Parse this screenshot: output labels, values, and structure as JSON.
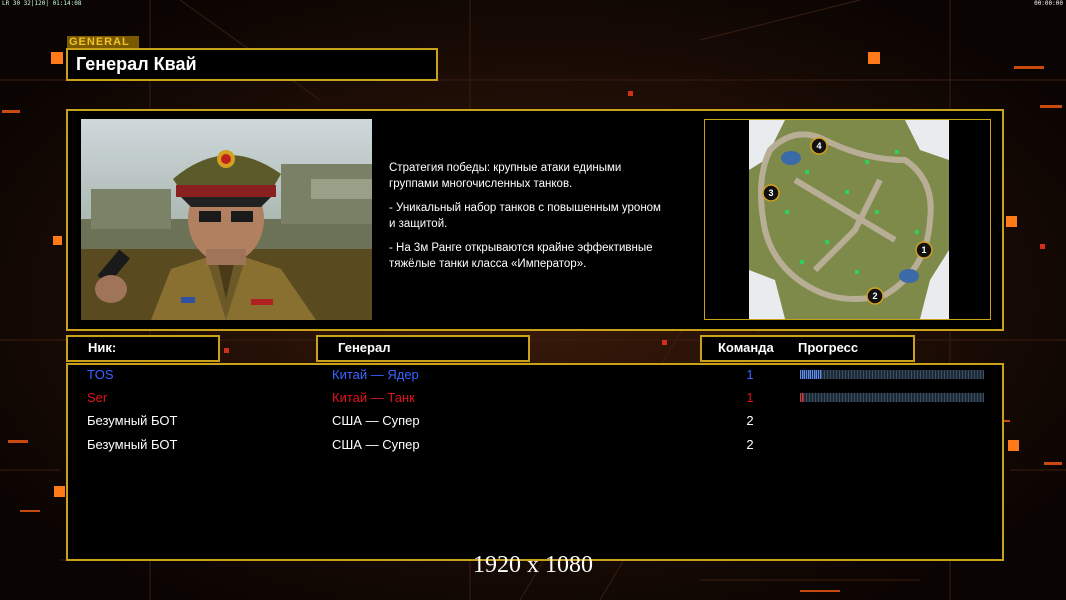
{
  "hud": {
    "left": "LR 30 32|120| 01:14:08",
    "right": "00:00:00"
  },
  "general_tag": "GENERAL",
  "general_name": "Генерал Квай",
  "description": [
    "Стратегия победы: крупные атаки едиными\n группами многочисленных танков.",
    "- Уникальный набор танков с повышенным уроном\n и защитой.",
    "- На 3м Ранге открываются крайне эффективные\n тяжёлые танки класса «Император»."
  ],
  "map": {
    "positions": [
      "1",
      "2",
      "3",
      "4"
    ]
  },
  "columns": {
    "nick": "Ник:",
    "general": "Генерал",
    "team": "Команда",
    "progress": "Прогресс"
  },
  "players": [
    {
      "nick": "TOS",
      "general": "Китай — Ядер",
      "team": "1",
      "color": "#3a63ff",
      "progress": 0.12,
      "bar_color": "#5b8cff"
    },
    {
      "nick": "Ser",
      "general": "Китай — Танк",
      "team": "1",
      "color": "#e0141b",
      "progress": 0.02,
      "bar_color": "#ff2a2a"
    },
    {
      "nick": "Безумный БОТ",
      "general": "США — Супер",
      "team": "2",
      "color": "#ffffff"
    },
    {
      "nick": "Безумный БОТ",
      "general": "США — Супер",
      "team": "2",
      "color": "#ffffff"
    }
  ],
  "footer": "1920 x 1080",
  "accent": "#c9a21a"
}
